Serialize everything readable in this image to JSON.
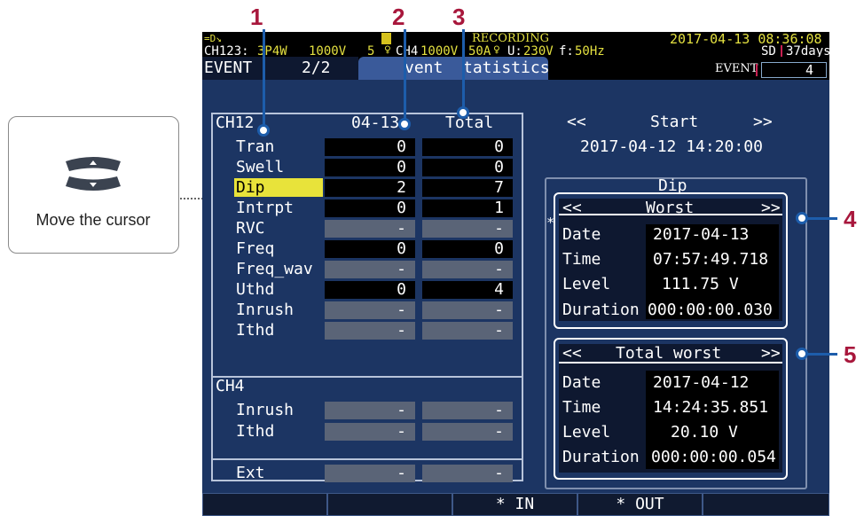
{
  "callouts": {
    "n1": "1",
    "n2": "2",
    "n3": "3",
    "n4": "4",
    "n5": "5"
  },
  "cursor_caption": "Move the cursor",
  "cursor_key_icon": "up-down-cursor-key-icon",
  "status": {
    "recording": "RECORDING",
    "datetime": "2017-04-13 08:36:08",
    "ch123_prefix": "CH123:",
    "wiring": "3P4W",
    "range_v1": "1000V",
    "range_a1": "5",
    "ch4_label": "CH4",
    "range_v2": "1000V",
    "range_a2": "50A",
    "u_label": "U:",
    "u_value": "230V",
    "f_label": "f:",
    "f_value": "50Hz",
    "sd_label": "SD",
    "sd_days": "37days",
    "event_label": "EVENT",
    "event_count": "4"
  },
  "tab": {
    "event_prefix": "EVENT",
    "page": "2/2",
    "title_a": "vent",
    "title_b": "tatistics"
  },
  "table": {
    "ch123": "CH12",
    "col_date": "04-13",
    "col_total": "Total",
    "rows": [
      {
        "label": "Tran",
        "day": "0",
        "total": "0"
      },
      {
        "label": "Swell",
        "day": "0",
        "total": "0"
      },
      {
        "label": "Dip",
        "day": "2",
        "total": "7"
      },
      {
        "label": "Intrpt",
        "day": "0",
        "total": "1"
      },
      {
        "label": "RVC",
        "day": "-",
        "total": "-"
      },
      {
        "label": "Freq",
        "day": "0",
        "total": "0"
      },
      {
        "label": "Freq_wav",
        "day": "-",
        "total": "-"
      },
      {
        "label": "Uthd",
        "day": "0",
        "total": "4"
      },
      {
        "label": "Inrush",
        "day": "-",
        "total": "-"
      },
      {
        "label": "Ithd",
        "day": "-",
        "total": "-"
      }
    ],
    "ch4": "CH4",
    "ch4_rows": [
      {
        "label": "Inrush",
        "day": "-",
        "total": "-"
      },
      {
        "label": "Ithd",
        "day": "-",
        "total": "-"
      }
    ],
    "ext": {
      "label": "Ext",
      "day": "-",
      "total": "-"
    }
  },
  "right": {
    "prev": "<<",
    "start_label": "Start",
    "next": ">>",
    "start_datetime": "2017-04-12 14:20:00",
    "event_type": "Dip",
    "asterisk": "*",
    "worst": {
      "prev": "<<",
      "title": "Worst",
      "next": ">>",
      "date_label": "Date",
      "date": "2017-04-13",
      "time_label": "Time",
      "time": "07:57:49.718",
      "level_label": "Level",
      "level": "111.75 V",
      "duration_label": "Duration",
      "duration": "000:00:00.030"
    },
    "total_worst": {
      "prev": "<<",
      "title": "Total worst",
      "next": ">>",
      "date_label": "Date",
      "date": "2017-04-12",
      "time_label": "Time",
      "time": "14:24:35.851",
      "level_label": "Level",
      "level": "20.10 V",
      "duration_label": "Duration",
      "duration": "000:00:00.054"
    }
  },
  "fkeys": {
    "f1": "",
    "f2": "",
    "f3": "* IN",
    "f4": "* OUT",
    "f5": ""
  }
}
